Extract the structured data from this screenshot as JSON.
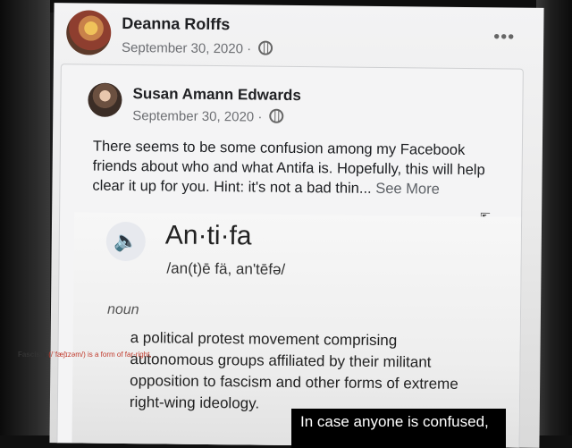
{
  "post": {
    "author": "Deanna Rolffs",
    "date": "September 30, 2020 ·",
    "more_icon": "•••"
  },
  "shared": {
    "author": "Susan Amann Edwards",
    "date": "September 30, 2020 ·",
    "text": "There seems to be some confusion among my Facebook friends about who and what Antifa is. Hopefully, this will help clear it up for you. Hint: it's not a bad thin...",
    "see_more": "See More"
  },
  "dictionary": {
    "speaker_icon": "🔈",
    "word": "An·ti·fa",
    "pronunciation": "/an(t)ē fä, an'tēfə/",
    "part_of_speech": "noun",
    "definition": "a political protest movement comprising autonomous groups affiliated by their militant opposition to fascism and other forms of extreme right-wing ideology."
  },
  "footer": {
    "label": "Fascism",
    "text": "(/ˈfæʃɪzəm/) is a form of far-right,"
  },
  "caption": {
    "text": "In case anyone is confused,"
  }
}
